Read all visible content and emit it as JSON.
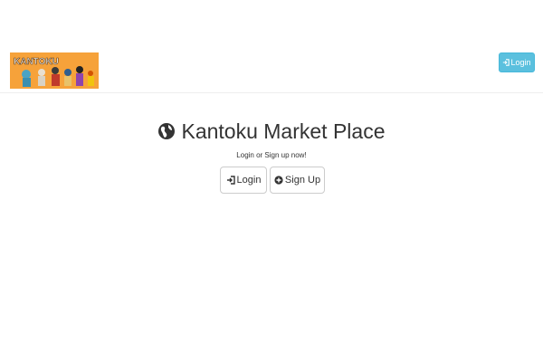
{
  "navbar": {
    "logo_text": "KANTOKU",
    "login_label": "Login"
  },
  "main": {
    "title": "Kantoku Market Place",
    "subtitle": "Login or Sign up now!",
    "login_label": "Login",
    "signup_label": "Sign Up"
  },
  "colors": {
    "logo_bg": "#f6a23a",
    "nav_button": "#5bc0de"
  },
  "icons": {
    "login": "sign-in-icon",
    "signup": "plus-circle-icon",
    "globe": "globe-icon"
  }
}
